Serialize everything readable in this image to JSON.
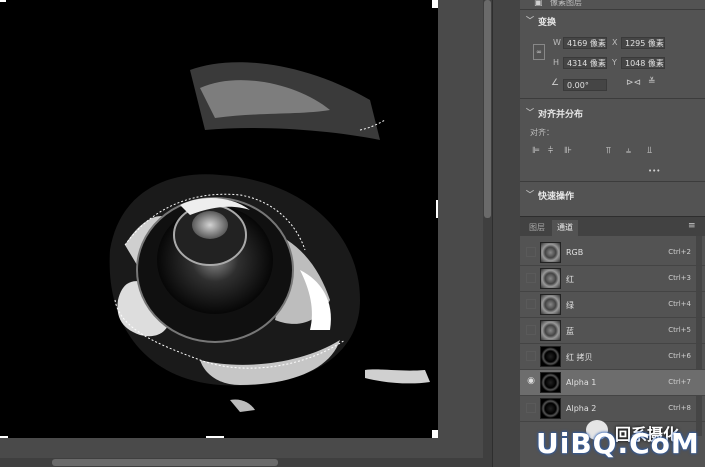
{
  "transform": {
    "top_label": "像素图层",
    "header": "变换",
    "w_label": "W",
    "w_value": "4169 像素",
    "x_label": "X",
    "x_value": "1295 像素",
    "h_label": "H",
    "h_value": "4314 像素",
    "y_label": "Y",
    "y_value": "1048 像素",
    "angle_value": "0.00°"
  },
  "align": {
    "header": "对齐并分布",
    "label": "对齐：",
    "more": "•••"
  },
  "quick": {
    "header": "快速操作"
  },
  "channels": {
    "tabs": [
      "图层",
      "通道"
    ],
    "rows": [
      {
        "name": "RGB",
        "shortcut": "Ctrl+2",
        "thumb": "gray",
        "visible": false,
        "selected": false
      },
      {
        "name": "红",
        "shortcut": "Ctrl+3",
        "thumb": "gray",
        "visible": false,
        "selected": false
      },
      {
        "name": "绿",
        "shortcut": "Ctrl+4",
        "thumb": "gray",
        "visible": false,
        "selected": false
      },
      {
        "name": "蓝",
        "shortcut": "Ctrl+5",
        "thumb": "gray",
        "visible": false,
        "selected": false
      },
      {
        "name": "红 拷贝",
        "shortcut": "Ctrl+6",
        "thumb": "dark",
        "visible": false,
        "selected": false
      },
      {
        "name": "Alpha 1",
        "shortcut": "Ctrl+7",
        "thumb": "dark",
        "visible": true,
        "selected": true
      },
      {
        "name": "Alpha 2",
        "shortcut": "Ctrl+8",
        "thumb": "dark",
        "visible": false,
        "selected": false
      }
    ]
  },
  "watermark": {
    "brand": "UiBQ.CoM",
    "sub": "回系摄化"
  },
  "colors": {
    "panel_bg": "#535353",
    "selected_row": "#6d6d6d",
    "watermark_blue": "#2a5db0"
  }
}
